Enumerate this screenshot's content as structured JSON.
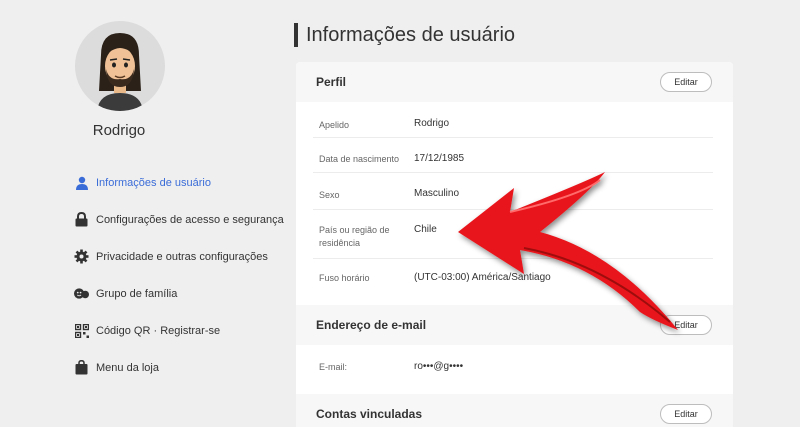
{
  "sidebar": {
    "username": "Rodrigo",
    "items": [
      {
        "label": "Informações de usuário",
        "icon": "user-icon"
      },
      {
        "label": "Configurações de acesso e segurança",
        "icon": "lock-icon"
      },
      {
        "label": "Privacidade e outras configurações",
        "icon": "gear-icon"
      },
      {
        "label": "Grupo de família",
        "icon": "family-icon"
      },
      {
        "label": "Código QR · Registrar-se",
        "icon": "qr-code-icon"
      },
      {
        "label": "Menu da loja",
        "icon": "shopping-bag-icon"
      }
    ]
  },
  "main": {
    "title": "Informações de usuário",
    "profile": {
      "title": "Perfil",
      "edit_label": "Editar",
      "fields": [
        {
          "label": "Apelido",
          "value": "Rodrigo"
        },
        {
          "label": "Data de nascimento",
          "value": "17/12/1985"
        },
        {
          "label": "Sexo",
          "value": "Masculino"
        },
        {
          "label": "País ou região de residência",
          "value": "Chile"
        },
        {
          "label": "Fuso horário",
          "value": "(UTC-03:00) América/Santiago"
        }
      ]
    },
    "email": {
      "title": "Endereço de e-mail",
      "edit_label": "Editar",
      "label": "E-mail:",
      "value": "ro•••@g••••"
    },
    "linked": {
      "title": "Contas vinculadas",
      "edit_label": "Editar"
    }
  },
  "colors": {
    "accent": "#3a6cd8",
    "arrow": "#e8141a"
  }
}
